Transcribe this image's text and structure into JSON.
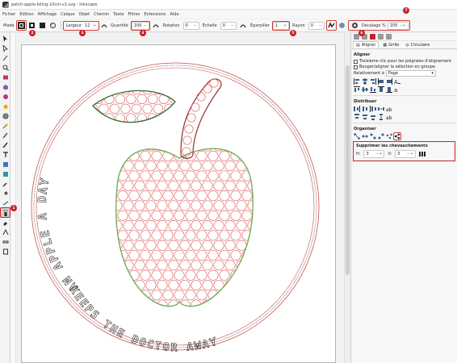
{
  "window": {
    "title": "patch-apple-biling-10cm-v2.svg - Inkscape"
  },
  "menu": [
    "Fichier",
    "Edition",
    "Affichage",
    "Calque",
    "Objet",
    "Chemin",
    "Texte",
    "Filtres",
    "Extensions",
    "Aide"
  ],
  "toolbar": {
    "mode_label": "Mode",
    "width_label": "Largeur",
    "width_value": "12",
    "quantity_label": "Quantité",
    "quantity_value": "100",
    "rotation_label": "Rotation",
    "rotation_value": "0",
    "scale_label": "Échelle",
    "scale_value": "0",
    "scatter_label": "Éparpiller",
    "scatter_value": "1",
    "radius_label": "Rayon",
    "radius_value": "0",
    "offset_label": "Décalage %",
    "offset_value": "105"
  },
  "badges": [
    "1",
    "2",
    "3",
    "4",
    "5",
    "6",
    "7"
  ],
  "artwork": {
    "text_top": "AN APPLE A DAY",
    "text_bottom": "KEEPS THE DOCTOR AWAY",
    "colors": {
      "apple": "#6aa84f",
      "leaf": "#2e6b2e",
      "stem": "#9b3b3b",
      "dots": "#e06666",
      "border": "#d24b4b"
    }
  },
  "dialog": {
    "tabs": [
      "Aligner",
      "Grille",
      "Circulaire"
    ],
    "align_section": "Aligner",
    "treat_selection": "Troisième clic pour les poignées d'alignement",
    "move_group": "Bouger/aligner la sélection en groupe",
    "relative_label": "Relativement à",
    "relative_value": "Page",
    "distribute_section": "Distribuer",
    "arrange_section": "Organiser",
    "overlap_section": "Supprimer les chevauchements",
    "h_label": "H:",
    "h_value": "3",
    "v_label": "V:",
    "v_value": "3"
  }
}
